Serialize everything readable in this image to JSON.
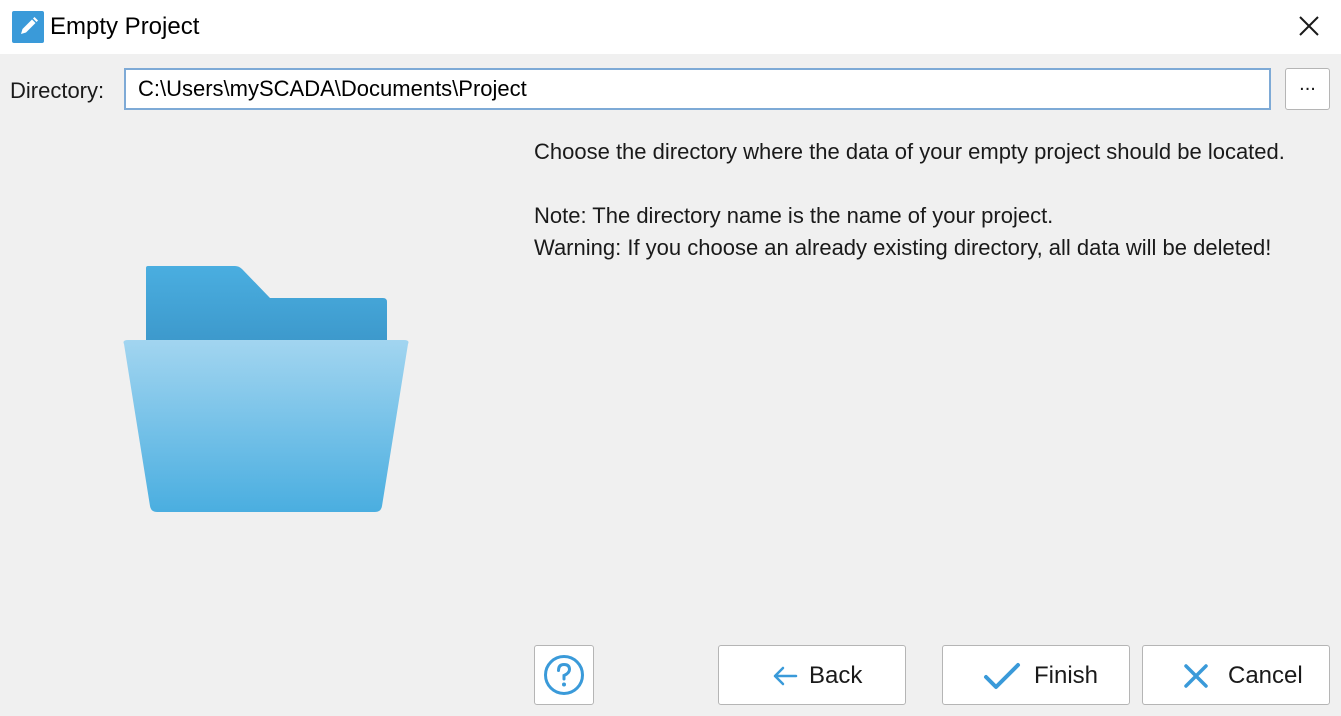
{
  "window": {
    "title": "Empty Project",
    "title_icon": "pencil-icon",
    "close_icon": "close-icon"
  },
  "directory": {
    "label": "Directory:",
    "value": "C:\\Users\\mySCADA\\Documents\\Project",
    "browse_label": "..."
  },
  "description": {
    "line1": "Choose the directory where the data of your empty project should be located.",
    "note": "Note: The directory name is the name of your project.",
    "warning": "Warning: If you choose an already existing directory, all data will be deleted!"
  },
  "illustration": {
    "icon": "folder-icon"
  },
  "buttons": {
    "help_icon": "help-icon",
    "back_label": "Back",
    "back_icon": "arrow-left-icon",
    "finish_label": "Finish",
    "finish_icon": "checkmark-icon",
    "cancel_label": "Cancel",
    "cancel_icon": "close-icon"
  },
  "colors": {
    "accent": "#3a9ad9",
    "folder_back": "#4aaee0",
    "folder_front_top": "#9fd3ef",
    "folder_front_bottom": "#4aaee0"
  }
}
